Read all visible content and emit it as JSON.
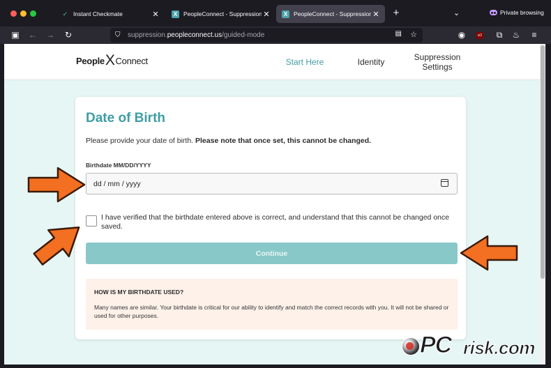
{
  "browser": {
    "tabs": [
      {
        "title": "Instant Checkmate",
        "active": false,
        "favicon": "checkmark-icon"
      },
      {
        "title": "PeopleConnect - Suppression C",
        "active": false,
        "favicon": "peopleconnect-icon"
      },
      {
        "title": "PeopleConnect - Suppression C",
        "active": true,
        "favicon": "peopleconnect-icon"
      }
    ],
    "private_label": "Private browsing",
    "url": {
      "host": "suppression.",
      "domain": "peopleconnect.us",
      "path": "/guided-mode"
    }
  },
  "site": {
    "logo": {
      "people": "People",
      "x": "X",
      "connect": "Connect"
    },
    "nav": {
      "start": "Start Here",
      "identity": "Identity",
      "suppression_line1": "Suppression",
      "suppression_line2": "Settings"
    }
  },
  "form": {
    "title": "Date of Birth",
    "intro_plain": "Please provide your date of birth. ",
    "intro_bold": "Please note that once set, this cannot be changed.",
    "field_label": "Birthdate MM/DD/YYYY",
    "date_placeholder": "dd / mm / yyyy",
    "checkbox_label": "I have verified that the birthdate entered above is correct, and understand that this cannot be changed once saved.",
    "checkbox_checked": false,
    "continue_label": "Continue",
    "info_heading": "HOW IS MY BIRTHDATE USED?",
    "info_text": "Many names are similar. Your birthdate is critical for our ability to identify and match the correct records with you. It will not be shared or used for other purposes."
  },
  "watermark": {
    "pc": "PC",
    "risk": "risk.com"
  },
  "colors": {
    "accent": "#3e9ea4",
    "button": "#88c8c9",
    "page_bg": "#e6f6f5",
    "info_bg": "#fdf1ea",
    "arrow": "#f36f21"
  }
}
